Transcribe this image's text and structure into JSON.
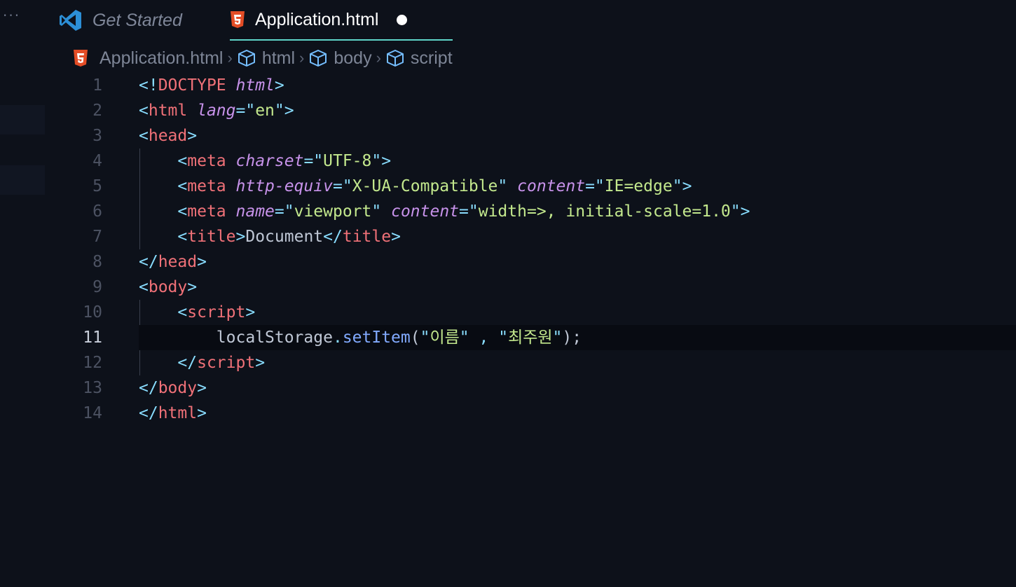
{
  "tabs": [
    {
      "label": "Get Started",
      "active": false
    },
    {
      "label": "Application.html",
      "active": true,
      "dirty": true
    }
  ],
  "breadcrumb": [
    {
      "label": "Application.html",
      "icon": "html5-icon"
    },
    {
      "label": "html",
      "icon": "cube-icon"
    },
    {
      "label": "body",
      "icon": "cube-icon"
    },
    {
      "label": "script",
      "icon": "cube-icon"
    }
  ],
  "colors": {
    "background": "#0d111a",
    "tag": "#f07178",
    "punctuation": "#89ddff",
    "attribute": "#c792ea",
    "string": "#c3e88d",
    "active_tab_border": "#5ed4c8"
  },
  "editor": {
    "current_line": 11,
    "lines": [
      {
        "n": "1",
        "tokens": [
          [
            "<!",
            "p"
          ],
          [
            "DOCTYPE",
            "t"
          ],
          [
            " ",
            "x"
          ],
          [
            "html",
            "a"
          ],
          [
            ">",
            "p"
          ]
        ]
      },
      {
        "n": "2",
        "tokens": [
          [
            "<",
            "p"
          ],
          [
            "html",
            "t"
          ],
          [
            " ",
            "x"
          ],
          [
            "lang",
            "a"
          ],
          [
            "=\"",
            "p"
          ],
          [
            "en",
            "s"
          ],
          [
            "\"",
            "p"
          ],
          [
            ">",
            "p"
          ]
        ]
      },
      {
        "n": "3",
        "tokens": [
          [
            "<",
            "p"
          ],
          [
            "head",
            "t"
          ],
          [
            ">",
            "p"
          ]
        ]
      },
      {
        "n": "4",
        "tokens": [
          [
            "    ",
            "x"
          ],
          [
            "<",
            "p"
          ],
          [
            "meta",
            "t"
          ],
          [
            " ",
            "x"
          ],
          [
            "charset",
            "a"
          ],
          [
            "=\"",
            "p"
          ],
          [
            "UTF-8",
            "s"
          ],
          [
            "\"",
            "p"
          ],
          [
            ">",
            "p"
          ]
        ]
      },
      {
        "n": "5",
        "tokens": [
          [
            "    ",
            "x"
          ],
          [
            "<",
            "p"
          ],
          [
            "meta",
            "t"
          ],
          [
            " ",
            "x"
          ],
          [
            "http-equiv",
            "a"
          ],
          [
            "=\"",
            "p"
          ],
          [
            "X-UA-Compatible",
            "s"
          ],
          [
            "\"",
            "p"
          ],
          [
            " ",
            "x"
          ],
          [
            "content",
            "a"
          ],
          [
            "=\"",
            "p"
          ],
          [
            "IE=edge",
            "s"
          ],
          [
            "\"",
            "p"
          ],
          [
            ">",
            "p"
          ]
        ]
      },
      {
        "n": "6",
        "tokens": [
          [
            "    ",
            "x"
          ],
          [
            "<",
            "p"
          ],
          [
            "meta",
            "t"
          ],
          [
            " ",
            "x"
          ],
          [
            "name",
            "a"
          ],
          [
            "=\"",
            "p"
          ],
          [
            "viewport",
            "s"
          ],
          [
            "\"",
            "p"
          ],
          [
            " ",
            "x"
          ],
          [
            "content",
            "a"
          ],
          [
            "=\"",
            "p"
          ],
          [
            "width=>, initial-scale=1.0",
            "s"
          ],
          [
            "\"",
            "p"
          ],
          [
            ">",
            "p"
          ]
        ]
      },
      {
        "n": "7",
        "tokens": [
          [
            "    ",
            "x"
          ],
          [
            "<",
            "p"
          ],
          [
            "title",
            "t"
          ],
          [
            ">",
            "p"
          ],
          [
            "Document",
            "x"
          ],
          [
            "</",
            "p"
          ],
          [
            "title",
            "t"
          ],
          [
            ">",
            "p"
          ]
        ]
      },
      {
        "n": "8",
        "tokens": [
          [
            "</",
            "p"
          ],
          [
            "head",
            "t"
          ],
          [
            ">",
            "p"
          ]
        ]
      },
      {
        "n": "9",
        "tokens": [
          [
            "<",
            "p"
          ],
          [
            "body",
            "t"
          ],
          [
            ">",
            "p"
          ]
        ]
      },
      {
        "n": "10",
        "tokens": [
          [
            "    ",
            "x"
          ],
          [
            "<",
            "p"
          ],
          [
            "script",
            "t"
          ],
          [
            ">",
            "p"
          ]
        ]
      },
      {
        "n": "11",
        "tokens": [
          [
            "        ",
            "x"
          ],
          [
            "localStorage",
            "x"
          ],
          [
            ".",
            "p"
          ],
          [
            "setItem",
            "f"
          ],
          [
            "(",
            "x"
          ],
          [
            "\"",
            "p"
          ],
          [
            "이름",
            "s"
          ],
          [
            "\"",
            "p"
          ],
          [
            " , ",
            "p"
          ],
          [
            "\"",
            "p"
          ],
          [
            "최주원",
            "s"
          ],
          [
            "\"",
            "p"
          ],
          [
            ");",
            "x"
          ]
        ]
      },
      {
        "n": "12",
        "tokens": [
          [
            "    ",
            "x"
          ],
          [
            "</",
            "p"
          ],
          [
            "script",
            "t"
          ],
          [
            ">",
            "p"
          ]
        ]
      },
      {
        "n": "13",
        "tokens": [
          [
            "</",
            "p"
          ],
          [
            "body",
            "t"
          ],
          [
            ">",
            "p"
          ]
        ]
      },
      {
        "n": "14",
        "tokens": [
          [
            "</",
            "p"
          ],
          [
            "html",
            "t"
          ],
          [
            ">",
            "p"
          ]
        ]
      }
    ]
  }
}
